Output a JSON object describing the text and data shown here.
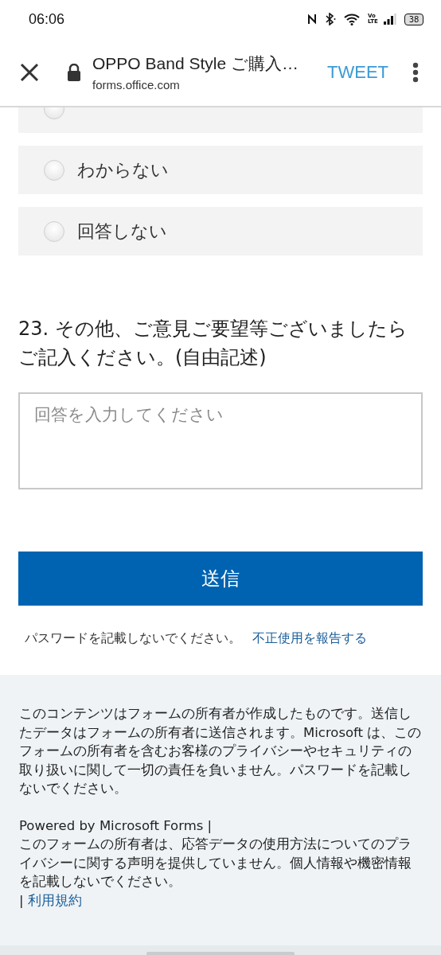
{
  "status_bar": {
    "time": "06:06",
    "volte_label": "Vo LTE",
    "battery": "38"
  },
  "browser_header": {
    "title": "OPPO Band Style ご購入…",
    "url": "forms.office.com",
    "action": "TWEET"
  },
  "choices": [
    {
      "selected": false
    },
    {
      "label": "わからない",
      "selected": false
    },
    {
      "label": "回答しない",
      "selected": false
    }
  ],
  "question": {
    "title": "23. その他、ご意見ご要望等ございましたらご記入ください。(自由記述)",
    "placeholder": "回答を入力してください"
  },
  "submit_button": "送信",
  "notice": {
    "text": "パスワードを記載しないでください。",
    "link": "不正使用を報告する"
  },
  "footer": {
    "disclaimer": "このコンテンツはフォームの所有者が作成したものです。送信したデータはフォームの所有者に送信されます。Microsoft は、このフォームの所有者を含むお客様のプライバシーやセキュリティの取り扱いに関して一切の責任を負いません。パスワードを記載しないでください。",
    "powered_by": "Powered by Microsoft Forms |",
    "privacy_note": "このフォームの所有者は、応答データの使用方法についてのプライバシーに関する声明を提供していません。個人情報や機密情報を記載しないでください。",
    "separator": "|",
    "terms_link": "利用規約"
  }
}
